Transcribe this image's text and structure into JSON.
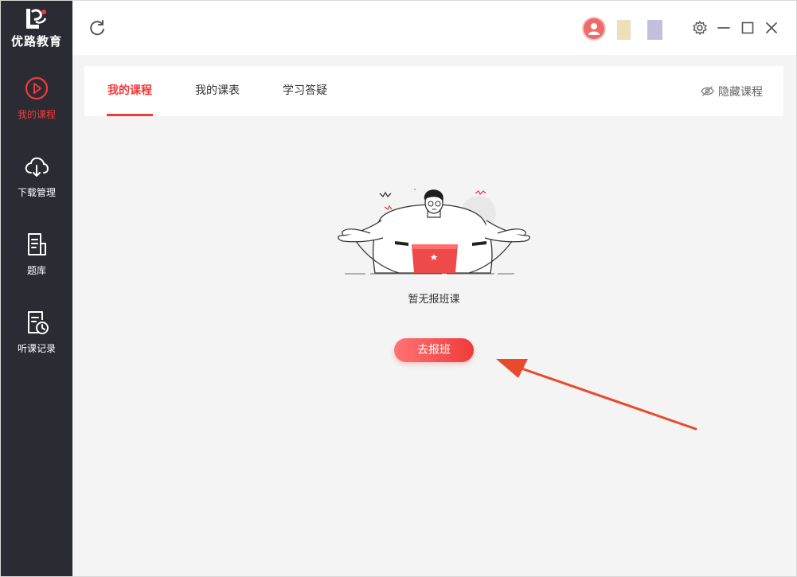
{
  "app": {
    "logo_text": "优路教育"
  },
  "sidebar": {
    "items": [
      {
        "label": "我的课程",
        "icon": "play-circle-icon",
        "active": true
      },
      {
        "label": "下载管理",
        "icon": "cloud-download-icon",
        "active": false
      },
      {
        "label": "题库",
        "icon": "document-icon",
        "active": false
      },
      {
        "label": "听课记录",
        "icon": "history-icon",
        "active": false
      }
    ]
  },
  "tabs": [
    {
      "label": "我的课程",
      "active": true
    },
    {
      "label": "我的课表",
      "active": false
    },
    {
      "label": "学习答疑",
      "active": false
    }
  ],
  "hide_courses_label": "隐藏课程",
  "empty_state": {
    "message": "暂无报班课",
    "button_label": "去报班"
  },
  "colors": {
    "accent": "#ef3b3b",
    "sidebar_bg": "#2a2b33",
    "content_bg": "#f4f4f4"
  }
}
